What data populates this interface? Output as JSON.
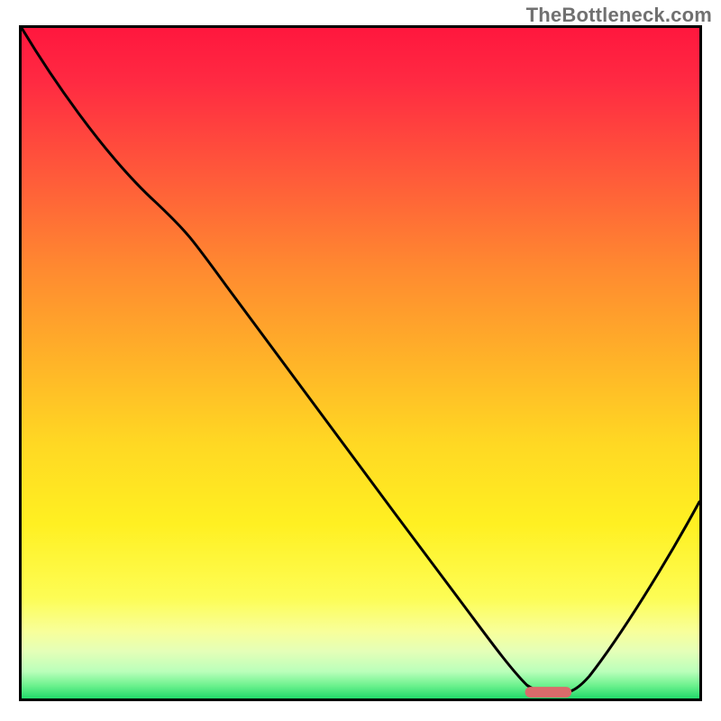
{
  "watermark": "TheBottleneck.com",
  "chart_data": {
    "type": "line",
    "title": "",
    "xlabel": "",
    "ylabel": "",
    "xlim": [
      0,
      100
    ],
    "ylim": [
      0,
      100
    ],
    "x": [
      0,
      6,
      15,
      22,
      30,
      40,
      50,
      60,
      67,
      72,
      75,
      78,
      81,
      86,
      92,
      100
    ],
    "values": [
      100,
      92,
      80,
      73,
      63,
      50,
      37,
      24,
      14,
      6,
      2,
      0.5,
      0.5,
      4,
      14,
      30
    ],
    "marker": {
      "x_start": 75,
      "x_end": 81,
      "y": 0.5
    },
    "gradient_scale": {
      "top_color": "#ff173e",
      "mid_color": "#ffd823",
      "bottom_color": "#22d96a"
    }
  }
}
